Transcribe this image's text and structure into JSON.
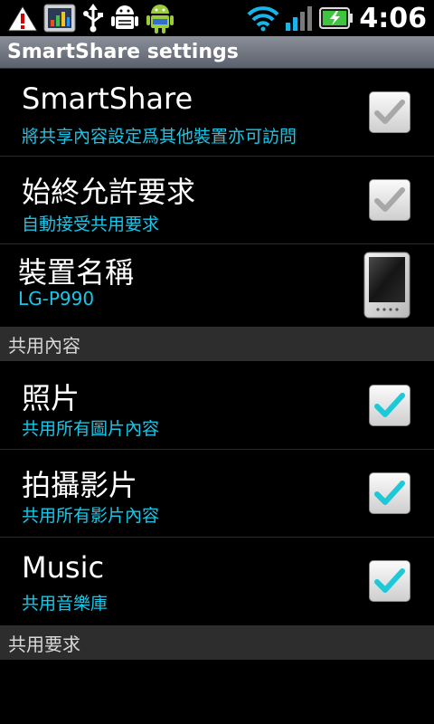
{
  "status_bar": {
    "time": "4:06",
    "icons_left": [
      "warning-icon",
      "chart-app-icon",
      "usb-icon",
      "android-debug-icon",
      "android-icon"
    ],
    "icons_right": [
      "wifi-icon",
      "signal-icon",
      "battery-charging-icon"
    ]
  },
  "title_bar": {
    "title": "SmartShare settings"
  },
  "rows": [
    {
      "title": "SmartShare",
      "subtitle": "將共享內容設定爲其他裝置亦可訪問",
      "checked": true,
      "enabled": false
    },
    {
      "title": "始終允許要求",
      "subtitle": "自動接受共用要求",
      "checked": true,
      "enabled": false
    },
    {
      "title": "裝置名稱",
      "subtitle": "LG-P990",
      "icon": "device-icon"
    },
    {
      "title": "照片",
      "subtitle": "共用所有圖片內容",
      "checked": true,
      "enabled": true
    },
    {
      "title": "拍攝影片",
      "subtitle": "共用所有影片內容",
      "checked": true,
      "enabled": true
    },
    {
      "title": "Music",
      "subtitle": "共用音樂庫",
      "checked": true,
      "enabled": true
    }
  ],
  "sections": {
    "shared_content": "共用內容",
    "shared_requests": "共用要求"
  },
  "colors": {
    "subtitle": "#19c6e8",
    "check_enabled": "#1ec8d6",
    "check_disabled": "#a8a8a8",
    "section_bg": "#2d2d2d"
  }
}
